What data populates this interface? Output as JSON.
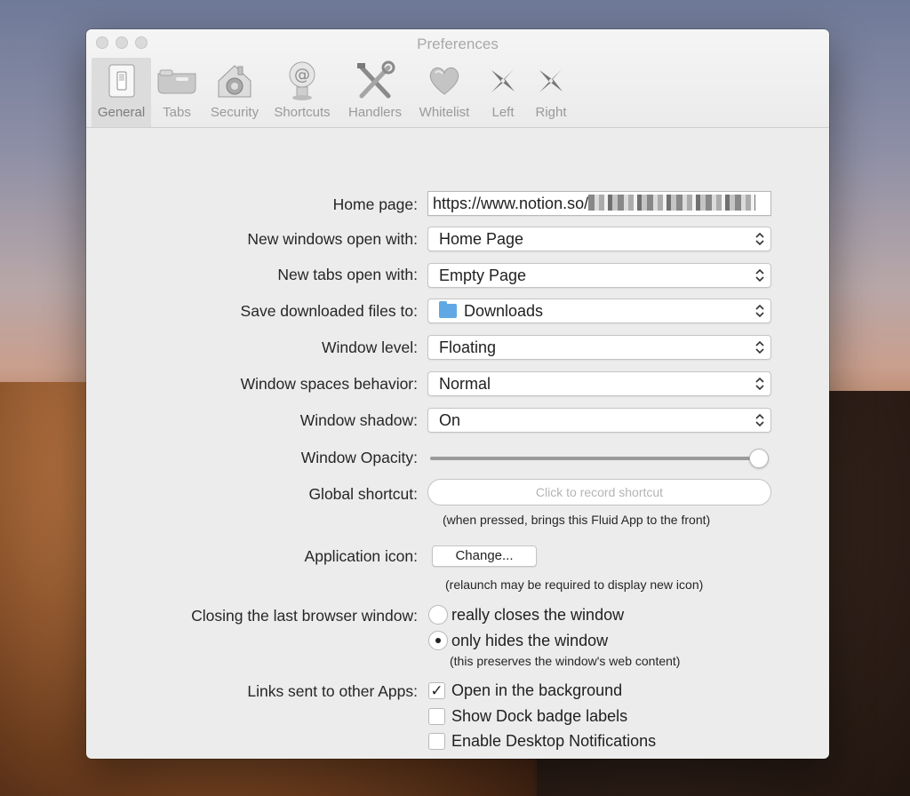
{
  "window": {
    "title": "Preferences"
  },
  "toolbar": [
    {
      "label": "General",
      "icon": "light-switch-icon",
      "selected": true
    },
    {
      "label": "Tabs",
      "icon": "tabs-icon",
      "selected": false
    },
    {
      "label": "Security",
      "icon": "house-lock-icon",
      "selected": false
    },
    {
      "label": "Shortcuts",
      "icon": "at-sign-icon",
      "selected": false
    },
    {
      "label": "Handlers",
      "icon": "tools-icon",
      "selected": false
    },
    {
      "label": "Whitelist",
      "icon": "heart-icon",
      "selected": false
    },
    {
      "label": "Left",
      "icon": "shuriken-left-icon",
      "selected": false
    },
    {
      "label": "Right",
      "icon": "shuriken-right-icon",
      "selected": false
    }
  ],
  "form": {
    "home_page": {
      "label": "Home page:",
      "value": "https://www.notion.so/"
    },
    "new_windows": {
      "label": "New windows open with:",
      "value": "Home Page"
    },
    "new_tabs": {
      "label": "New tabs open with:",
      "value": "Empty Page"
    },
    "save_downloads": {
      "label": "Save downloaded files to:",
      "value": "Downloads",
      "icon": "folder-icon"
    },
    "window_level": {
      "label": "Window level:",
      "value": "Floating"
    },
    "window_spaces": {
      "label": "Window spaces behavior:",
      "value": "Normal"
    },
    "window_shadow": {
      "label": "Window shadow:",
      "value": "On"
    },
    "window_opacity": {
      "label": "Window Opacity:",
      "value": 1.0
    },
    "global_shortcut": {
      "label": "Global shortcut:",
      "placeholder": "Click to record shortcut",
      "note": "(when pressed, brings this Fluid App to the front)"
    },
    "app_icon": {
      "label": "Application icon:",
      "button": "Change...",
      "note": "(relaunch may be required to display new icon)"
    },
    "closing": {
      "label": "Closing the last browser window:",
      "options": [
        {
          "label": "really closes the window",
          "selected": false
        },
        {
          "label": "only hides the window",
          "selected": true
        }
      ],
      "note": "(this preserves the window's web content)"
    },
    "links": {
      "label": "Links sent to other Apps:",
      "options": [
        {
          "label": "Open in the background",
          "checked": true
        },
        {
          "label": "Show Dock badge labels",
          "checked": false
        },
        {
          "label": "Enable Desktop Notifications",
          "checked": false
        }
      ]
    }
  }
}
